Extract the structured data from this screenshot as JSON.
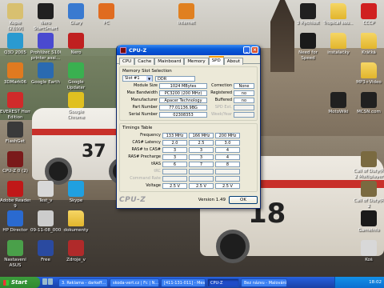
{
  "window": {
    "title": "CPU-Z",
    "tabs": [
      "CPU",
      "Cache",
      "Mainboard",
      "Memory",
      "SPD",
      "About"
    ],
    "active_tab": "SPD",
    "slot_group_title": "Memory Slot Selection",
    "slot": {
      "selected": "Slot #1",
      "type": "DDR",
      "module_size_label": "Module Size",
      "module_size": "1024 MBytes",
      "max_bandwidth_label": "Max Bandwidth",
      "max_bandwidth": "PC3200 (200 MHz)",
      "manufacturer_label": "Manufacturer",
      "manufacturer": "Apacer Technology",
      "part_number_label": "Part Number",
      "part_number": "77.01136.9BG",
      "serial_number_label": "Serial Number",
      "serial_number": "02308353",
      "correction_label": "Correction",
      "correction": "None",
      "registered_label": "Registered",
      "registered": "no",
      "buffered_label": "Buffered",
      "buffered": "no",
      "spd_ext_label": "SPD Ext.",
      "week_year_label": "Week/Year"
    },
    "timings_group_title": "Timings Table",
    "timings": {
      "rows": [
        {
          "label": "Frequency",
          "values": [
            "133 MHz",
            "166 MHz",
            "200 MHz"
          ],
          "dim": false
        },
        {
          "label": "CAS# Latency",
          "values": [
            "2.0",
            "2.5",
            "3.0"
          ],
          "dim": false
        },
        {
          "label": "RAS# to CAS#",
          "values": [
            "3",
            "3",
            "4"
          ],
          "dim": false
        },
        {
          "label": "RAS# Precharge",
          "values": [
            "3",
            "3",
            "4"
          ],
          "dim": false
        },
        {
          "label": "tRAS",
          "values": [
            "6",
            "7",
            "8"
          ],
          "dim": false
        },
        {
          "label": "tRC",
          "values": [
            "",
            "",
            ""
          ],
          "dim": true
        },
        {
          "label": "Command Rate",
          "values": [
            "",
            "",
            ""
          ],
          "dim": true
        },
        {
          "label": "Voltage",
          "values": [
            "2.5 V",
            "2.5 V",
            "2.5 V"
          ],
          "dim": false
        }
      ]
    },
    "version": "Version 1.49",
    "brand": "CPU-Z",
    "ok_label": "OK"
  },
  "desktop_icons": [
    {
      "label": "Kopie\n(2)[09]",
      "col": 0,
      "row": 0,
      "color": "#d8c070"
    },
    {
      "label": "Nero\nStartSmart",
      "col": 1,
      "row": 0,
      "color": "#202020"
    },
    {
      "label": "Glary",
      "col": 2,
      "row": 0,
      "color": "#3a7ad0"
    },
    {
      "label": "Internet",
      "col": 5,
      "row": 0,
      "color": "#e08020"
    },
    {
      "label": "PC",
      "col": 3,
      "row": 0,
      "color": "#e06c20"
    },
    {
      "label": "Q3D 2005",
      "col": 0,
      "row": 1,
      "color": "#2a9ad0"
    },
    {
      "label": "Prohlížeč S100\nprinter assi...",
      "col": 1,
      "row": 1,
      "color": "#4a4ad0"
    },
    {
      "label": "Nero",
      "col": 2,
      "row": 1,
      "color": "#c02020"
    },
    {
      "label": "3DMark06",
      "col": 0,
      "row": 2,
      "color": "#e07a20"
    },
    {
      "label": "Google Earth",
      "col": 1,
      "row": 2,
      "color": "#2a6ab0"
    },
    {
      "label": "Google\nUpdater",
      "col": 2,
      "row": 2,
      "color": "#3ab050"
    },
    {
      "label": "EVEREST Home\nEdition",
      "col": 0,
      "row": 3,
      "color": "#d02a2a"
    },
    {
      "label": "Google\nChrome",
      "col": 2,
      "row": 3,
      "color": "#e0c020"
    },
    {
      "label": "FlashGet",
      "col": 0,
      "row": 4,
      "color": "#3a3a3a"
    },
    {
      "label": "CPU-Z 0 (2)",
      "col": 0,
      "row": 5,
      "color": "#7a1a1a"
    },
    {
      "label": "Adobe Reader\n9",
      "col": 0,
      "row": 6,
      "color": "#c01818"
    },
    {
      "label": "Test_v",
      "col": 1,
      "row": 6,
      "color": "#d8d8d8"
    },
    {
      "label": "Skype",
      "col": 2,
      "row": 6,
      "color": "#20a0e0"
    },
    {
      "label": "HP Director",
      "col": 0,
      "row": 7,
      "color": "#2a6ad0"
    },
    {
      "label": "09-11-08_0002",
      "col": 1,
      "row": 7,
      "color": "#cccccc"
    },
    {
      "label": "dokumenty",
      "col": 2,
      "row": 7,
      "color": "#e8c050"
    },
    {
      "label": "Nastavení\nASUS",
      "col": 0,
      "row": 8,
      "color": "#4aa04a"
    },
    {
      "label": "Free",
      "col": 1,
      "row": 8,
      "color": "#2a4aa0"
    },
    {
      "label": "Zdroje_v",
      "col": 2,
      "row": 8,
      "color": "#b02a2a"
    },
    {
      "label": "3 Rychlost",
      "col": 8,
      "row": 0,
      "color": "#202020"
    },
    {
      "label": "Tropical sou...",
      "col": 9,
      "row": 0,
      "color": "#e8c050"
    },
    {
      "label": "CCCP",
      "col": 10,
      "row": 0,
      "color": "#d02020"
    },
    {
      "label": "Need for\nSpeed",
      "col": 8,
      "row": 1,
      "color": "#1a1a1a"
    },
    {
      "label": "instalačky",
      "col": 9,
      "row": 1,
      "color": "#e8c050"
    },
    {
      "label": "Krátká",
      "col": 10,
      "row": 1,
      "color": "#e8c050"
    },
    {
      "label": "MP3+Video",
      "col": 10,
      "row": 2,
      "color": "#e8c050"
    },
    {
      "label": "MotoWiki",
      "col": 9,
      "row": 3,
      "color": "#202020"
    },
    {
      "label": "MCSN.com",
      "col": 10,
      "row": 3,
      "color": "#202020"
    },
    {
      "label": "Call of Duty(R)\n2 Multiplayer",
      "col": 10,
      "row": 5,
      "color": "#7a6a40"
    },
    {
      "label": "Call of Duty(R)\n2",
      "col": 10,
      "row": 6,
      "color": "#7a6a40"
    },
    {
      "label": "GameInfo",
      "col": 10,
      "row": 7,
      "color": "#1a1a1a"
    },
    {
      "label": "Koš",
      "col": 10,
      "row": 8,
      "color": "#d8d8d8"
    }
  ],
  "taskbar": {
    "start_label": "Start",
    "tasks": [
      {
        "label": "3. Reklama - darkeff...",
        "active": false
      },
      {
        "label": "skoda-vert.cz | Fc | N...",
        "active": false
      },
      {
        "label": "[411-131-011] - Mes...",
        "active": false
      },
      {
        "label": "CPU-Z",
        "active": true
      },
      {
        "label": "Bez názvu - Malování",
        "active": false
      }
    ],
    "clock": "18:02"
  }
}
